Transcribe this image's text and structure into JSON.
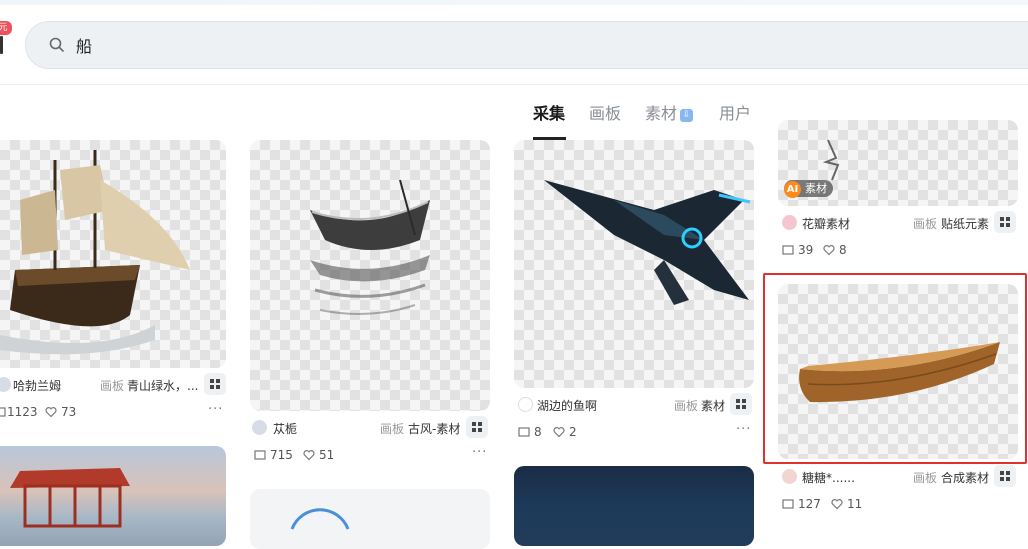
{
  "header": {
    "promo_badge": "元",
    "search": {
      "value": "船",
      "icon": "search-icon"
    }
  },
  "tabs": [
    {
      "label": "采集",
      "active": true
    },
    {
      "label": "画板",
      "active": false
    },
    {
      "label": "素材",
      "active": false,
      "badge": "⇩"
    },
    {
      "label": "用户",
      "active": false
    }
  ],
  "board_prefix": "画板",
  "cards": {
    "c1": {
      "user": "哈勃兰姆",
      "board": "青山绿水，...",
      "repins": "1123",
      "likes": "73"
    },
    "c2": {
      "user": "苁栀",
      "board": "古风-素材",
      "repins": "715",
      "likes": "51"
    },
    "c3": {
      "user": "湖边的鱼啊",
      "board": "素材",
      "repins": "8",
      "likes": "2"
    },
    "c4": {
      "ai_tag": "AI",
      "ai_label": "素材",
      "user": "花瓣素材",
      "board": "贴纸元素",
      "repins": "39",
      "likes": "8"
    },
    "c5": {
      "user": "糖糖*......",
      "board": "合成素材",
      "repins": "127",
      "likes": "11"
    }
  },
  "more_label": "···",
  "colors": {
    "highlight": "#e0302f",
    "tab_active": "#1a1a1a",
    "badge_red": "#f0505a"
  }
}
